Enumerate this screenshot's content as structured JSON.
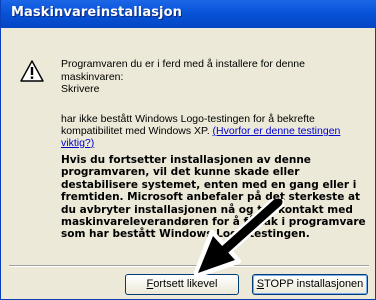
{
  "window": {
    "title": "Maskinvareinstallasjon"
  },
  "icon": {
    "name": "warning-icon"
  },
  "message": {
    "intro": "Programvaren du er i ferd med å installere for denne maskinvaren:",
    "device_name": "Skrivere",
    "logo_text": "har ikke bestått Windows Logo-testingen for å bekrefte kompatibilitet med Windows XP.",
    "logo_link": "(Hvorfor er denne testingen viktig?)",
    "warning": "Hvis du fortsetter installasjonen av denne programvaren, vil det kunne skade eller destabilisere systemet, enten med en gang eller i fremtiden. Microsoft anbefaler på det sterkeste at du avbryter installasjonen nå og tar kontakt med maskinvareleverandøren for å få tak i programvare som har bestått Windows Logo-testingen."
  },
  "buttons": {
    "continue": {
      "accesskey": "F",
      "rest": "ortsett likevel"
    },
    "stop": {
      "accesskey": "S",
      "rest": "TOPP installasjonen"
    }
  },
  "annotation": {
    "arrow": "arrow-pointer-icon",
    "color": "#000000"
  }
}
